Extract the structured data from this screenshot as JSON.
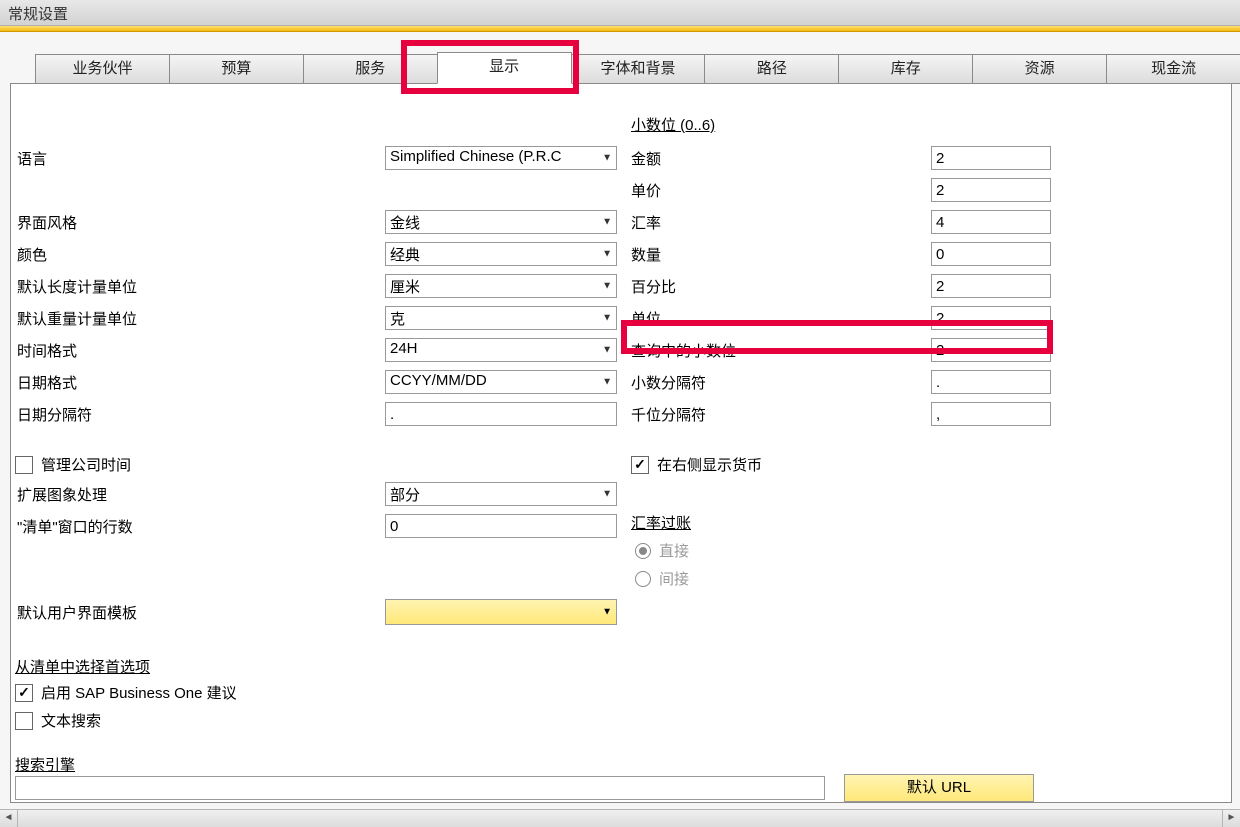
{
  "window_title": "常规设置",
  "tabs": [
    "业务伙伴",
    "预算",
    "服务",
    "显示",
    "字体和背景",
    "路径",
    "库存",
    "资源",
    "现金流"
  ],
  "left": {
    "language_label": "语言",
    "language_value": "Simplified Chinese (P.R.C",
    "skin_label": "界面风格",
    "skin_value": "金线",
    "color_label": "颜色",
    "color_value": "经典",
    "len_unit_label": "默认长度计量单位",
    "len_unit_value": "厘米",
    "weight_unit_label": "默认重量计量单位",
    "weight_unit_value": "克",
    "time_fmt_label": "时间格式",
    "time_fmt_value": "24H",
    "date_fmt_label": "日期格式",
    "date_fmt_value": "CCYY/MM/DD",
    "date_sep_label": "日期分隔符",
    "date_sep_value": ".",
    "manage_company_time": "管理公司时间",
    "ext_img_label": "扩展图象处理",
    "ext_img_value": "部分",
    "list_rows_label": "\"清单\"窗口的行数",
    "list_rows_value": "0",
    "ui_template_label": "默认用户界面模板",
    "pref_heading": "从清单中选择首选项",
    "enable_sap_suggest": "启用 SAP Business One 建议",
    "text_search": "文本搜索",
    "search_engine_label": "搜索引擎",
    "default_url_btn": "默认 URL"
  },
  "right": {
    "decimals_title": "小数位 (0..6)",
    "rows": [
      {
        "label": "金额",
        "value": "2"
      },
      {
        "label": "单价",
        "value": "2"
      },
      {
        "label": "汇率",
        "value": "4"
      },
      {
        "label": "数量",
        "value": "0"
      },
      {
        "label": "百分比",
        "value": "2"
      },
      {
        "label": "单位",
        "value": "2"
      },
      {
        "label": "查询中的小数位",
        "value": "2"
      },
      {
        "label": "小数分隔符",
        "value": "."
      },
      {
        "label": "千位分隔符",
        "value": ","
      }
    ],
    "show_currency_right": "在右侧显示货币",
    "posting_heading": "汇率过账",
    "radio_direct": "直接",
    "radio_indirect": "间接"
  }
}
